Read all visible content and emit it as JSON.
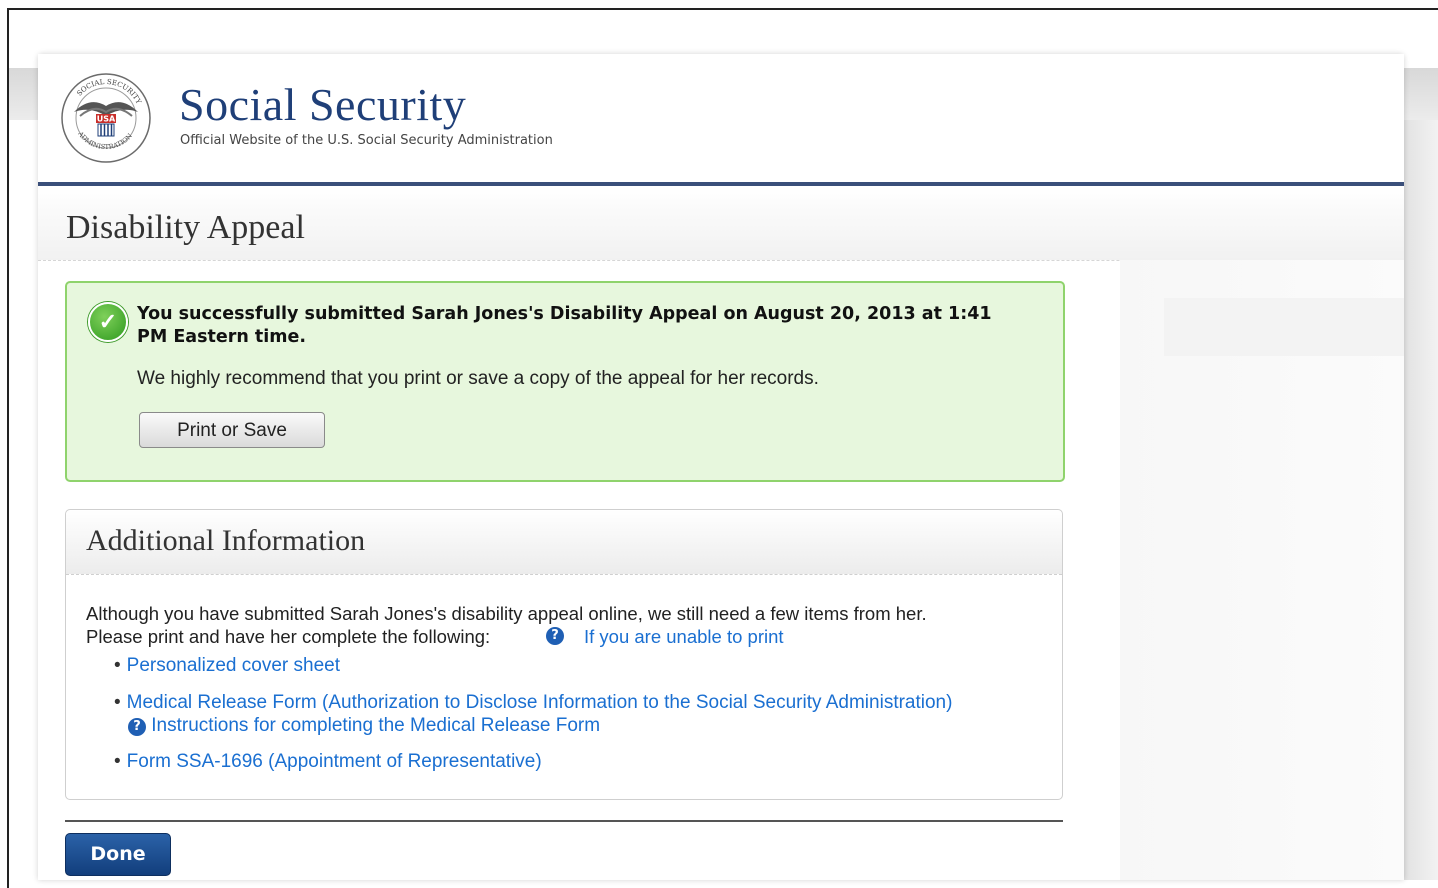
{
  "header": {
    "brand_title": "Social Security",
    "brand_subtitle": "Official Website of the U.S. Social Security Administration",
    "seal_text": "SOCIAL SECURITY ADMINISTRATION",
    "seal_usa": "USA"
  },
  "page": {
    "title": "Disability Appeal"
  },
  "success": {
    "message": "You successfully submitted Sarah Jones's Disability Appeal on August 20, 2013 at 1:41 PM Eastern time.",
    "recommendation": "We highly recommend that you print or save a copy of the appeal for her records.",
    "print_button": "Print or Save",
    "icon": "check-circle-icon",
    "color": "#e7f7dd"
  },
  "additional": {
    "title": "Additional Information",
    "intro_line1": "Although you have submitted Sarah Jones's disability appeal online, we still need a few items from her.",
    "intro_line2": "Please print and have her complete the following:",
    "unable_link": "If you are unable to print",
    "help_glyph": "?",
    "items": [
      {
        "label": "Personalized cover sheet"
      },
      {
        "label": "Medical Release Form (Authorization to Disclose Information to the Social Security Administration)",
        "sub": "Instructions for completing the Medical Release Form"
      },
      {
        "label": "Form SSA-1696 (Appointment of Representative)"
      }
    ]
  },
  "actions": {
    "done_button": "Done"
  },
  "colors": {
    "brand": "#1f3f78",
    "link": "#1a6fd1",
    "done": "#1a4d8f"
  }
}
